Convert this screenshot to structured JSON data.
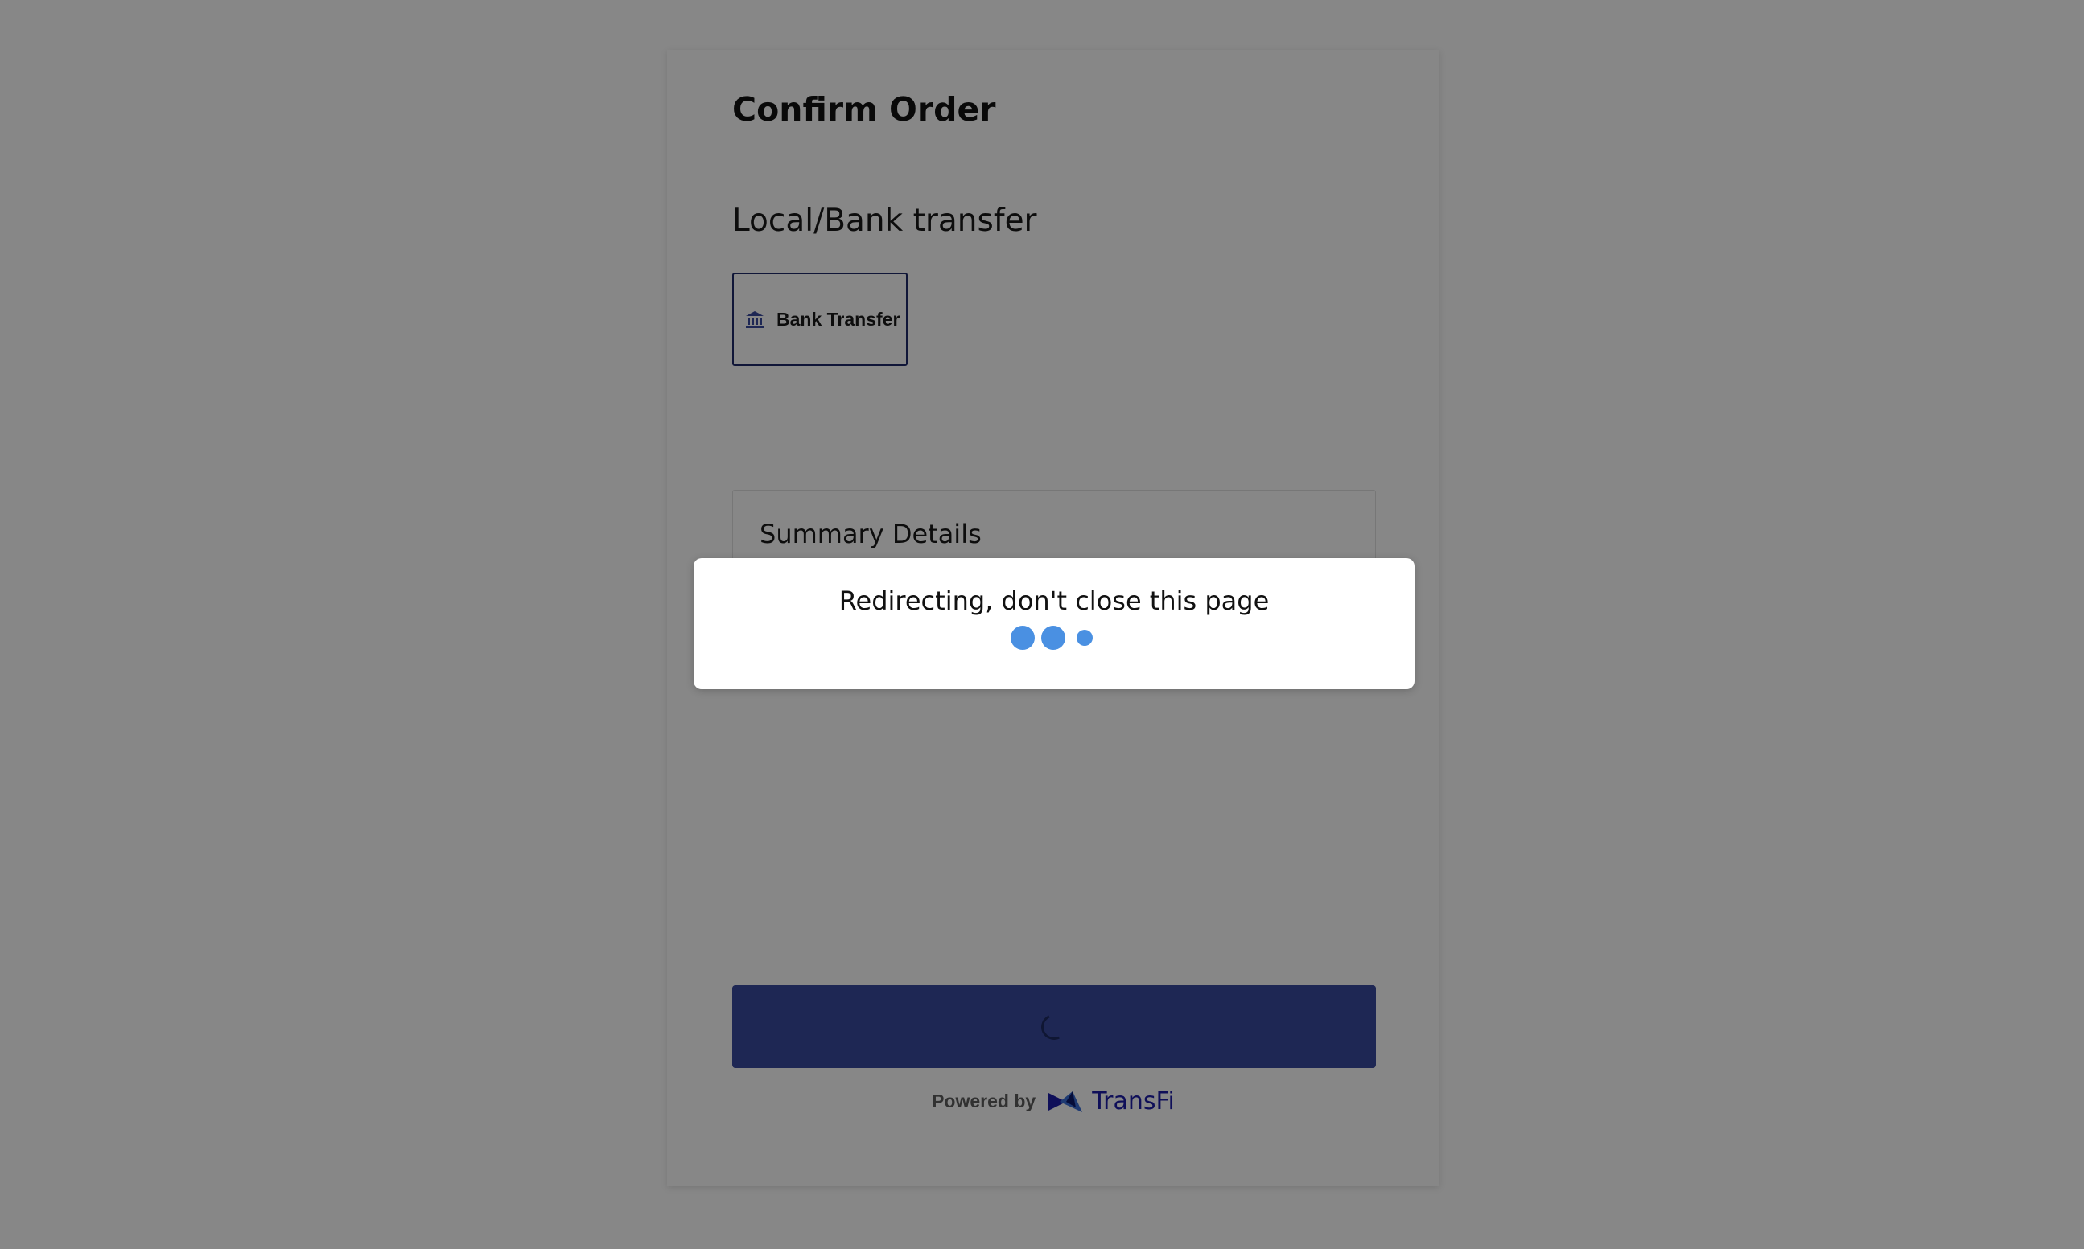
{
  "page": {
    "title": "Confirm Order",
    "section_title": "Local/Bank transfer"
  },
  "payment_method": {
    "label": "Bank Transfer",
    "icon": "bank-icon",
    "selected": true
  },
  "summary": {
    "title": "Summary Details"
  },
  "footer": {
    "powered_by": "Powered by",
    "brand": "TransFi",
    "brand_icon": "transfi-logo-icon"
  },
  "modal": {
    "message": "Redirecting, don't close this page",
    "loader_icon": "loading-dots-icon"
  },
  "colors": {
    "accent": "#3a4a9f",
    "brand": "#1e1ea8",
    "loader": "#4a90e2",
    "overlay": "rgba(0,0,0,0.47)"
  }
}
